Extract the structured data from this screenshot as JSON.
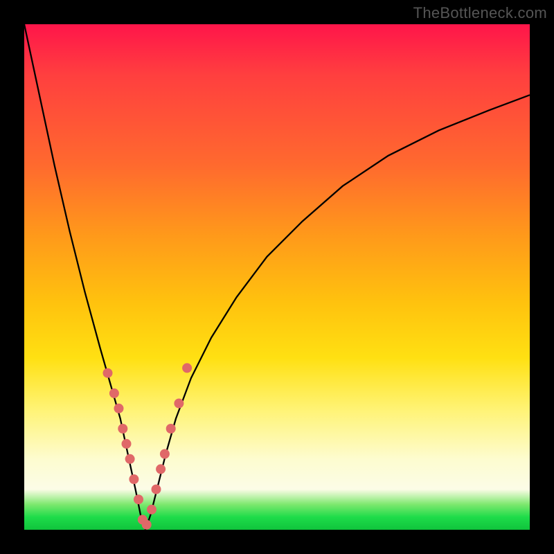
{
  "watermark": "TheBottleneck.com",
  "chart_data": {
    "type": "line",
    "title": "",
    "xlabel": "",
    "ylabel": "",
    "xlim": [
      0,
      100
    ],
    "ylim": [
      0,
      100
    ],
    "grid": false,
    "legend": false,
    "description": "V-shaped bottleneck curve over a vertical heat gradient; minimum near x≈24. Pink dots mark sampled points along the lower part of both arms.",
    "series": [
      {
        "name": "bottleneck-curve",
        "x": [
          0,
          3,
          6,
          9,
          12,
          15,
          17,
          19,
          20.5,
          22,
          23,
          24,
          25,
          26.5,
          28,
          30,
          33,
          37,
          42,
          48,
          55,
          63,
          72,
          82,
          92,
          100
        ],
        "y": [
          100,
          86,
          72,
          59,
          47,
          36,
          29,
          22,
          15,
          8,
          3,
          0,
          3,
          9,
          15,
          22,
          30,
          38,
          46,
          54,
          61,
          68,
          74,
          79,
          83,
          86
        ]
      }
    ],
    "sample_points": {
      "name": "highlighted-samples",
      "x": [
        16.5,
        17.8,
        18.7,
        19.5,
        20.2,
        20.9,
        21.7,
        22.6,
        23.4,
        24.2,
        25.2,
        26.1,
        27.0,
        27.8,
        29.0,
        30.6,
        32.2
      ],
      "y": [
        31,
        27,
        24,
        20,
        17,
        14,
        10,
        6,
        2,
        1,
        4,
        8,
        12,
        15,
        20,
        25,
        32
      ]
    },
    "gradient_stops": [
      {
        "pos": 0,
        "color": "#ff154a"
      },
      {
        "pos": 28,
        "color": "#ff6a2e"
      },
      {
        "pos": 55,
        "color": "#ffc20e"
      },
      {
        "pos": 86,
        "color": "#fdfccf"
      },
      {
        "pos": 97,
        "color": "#1edc4a"
      },
      {
        "pos": 100,
        "color": "#10c43c"
      }
    ]
  }
}
